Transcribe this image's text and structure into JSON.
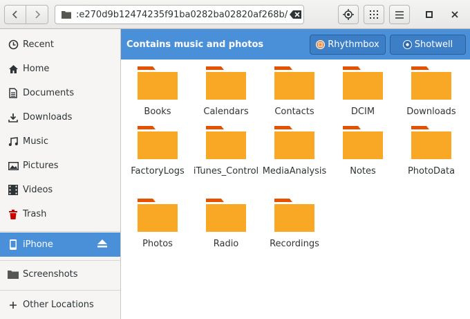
{
  "pathbar": {
    "path": ":e270d9b12474235f91ba0282ba02820af268b/"
  },
  "sidebar": {
    "items": [
      {
        "label": "Recent",
        "icon": "clock-icon"
      },
      {
        "label": "Home",
        "icon": "home-icon"
      },
      {
        "label": "Documents",
        "icon": "document-icon"
      },
      {
        "label": "Downloads",
        "icon": "download-icon"
      },
      {
        "label": "Music",
        "icon": "music-icon"
      },
      {
        "label": "Pictures",
        "icon": "picture-icon"
      },
      {
        "label": "Videos",
        "icon": "video-icon"
      },
      {
        "label": "Trash",
        "icon": "trash-icon"
      }
    ],
    "device": {
      "label": "iPhone",
      "icon": "phone-icon",
      "selected": true
    },
    "screenshots": {
      "label": "Screenshots",
      "icon": "folder-icon"
    },
    "other_locations": {
      "label": "Other Locations",
      "icon": "plus-icon"
    }
  },
  "infobar": {
    "message": "Contains music and photos",
    "rhythmbox_label": "Rhythmbox",
    "shotwell_label": "Shotwell"
  },
  "folders": [
    "Books",
    "Calendars",
    "Contacts",
    "DCIM",
    "Downloads",
    "FactoryLogs",
    "iTunes_Control",
    "MediaAnalysis",
    "Notes",
    "PhotoData",
    "Photos",
    "Radio",
    "Recordings"
  ],
  "colors": {
    "accent": "#4a90d9",
    "folder": "#f9a825",
    "folder_tab": "#e65100"
  }
}
